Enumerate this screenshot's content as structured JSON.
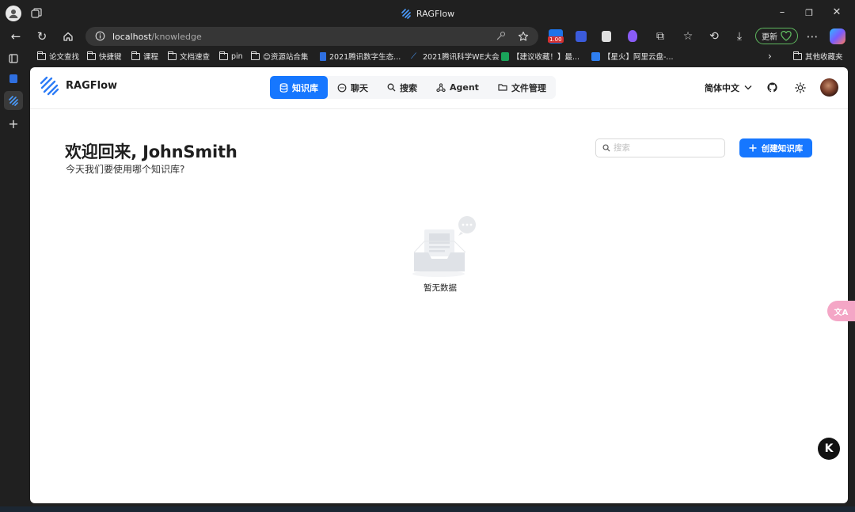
{
  "browser": {
    "tab_title": "RAGFlow",
    "url_host": "localhost",
    "url_path": "/knowledge",
    "extension_badge": "1.00",
    "update_label": "更新",
    "bookmarks": [
      {
        "label": "论文查找",
        "icon": "folder-icon"
      },
      {
        "label": "快捷键",
        "icon": "folder-icon"
      },
      {
        "label": "课程",
        "icon": "folder-icon"
      },
      {
        "label": "文档速查",
        "icon": "folder-icon"
      },
      {
        "label": "pin",
        "icon": "folder-icon"
      },
      {
        "label": "😊资源站合集",
        "icon": "folder-icon"
      },
      {
        "label": "2021腾讯数字生态...",
        "icon": "site-icon"
      },
      {
        "label": "2021腾讯科学WE大会",
        "icon": "site-icon"
      },
      {
        "label": "【建议收藏！】最...",
        "icon": "site-icon"
      },
      {
        "label": "【星火】阿里云盘-...",
        "icon": "site-icon"
      }
    ],
    "other_bookmarks": "其他收藏夹"
  },
  "app": {
    "name": "RAGFlow",
    "nav": [
      {
        "label": "知识库",
        "icon": "database-icon",
        "active": true
      },
      {
        "label": "聊天",
        "icon": "chat-icon",
        "active": false
      },
      {
        "label": "搜索",
        "icon": "search-icon",
        "active": false
      },
      {
        "label": "Agent",
        "icon": "agent-icon",
        "active": false
      },
      {
        "label": "文件管理",
        "icon": "folder-icon",
        "active": false
      }
    ],
    "language": "简体中文"
  },
  "main": {
    "welcome": "欢迎回来, JohnSmith",
    "subtitle": "今天我们要使用哪个知识库?",
    "search_placeholder": "搜索",
    "create_label": "创建知识库",
    "empty_text": "暂无数据"
  },
  "colors": {
    "accent": "#1677ff",
    "browser_bg": "#202020"
  }
}
